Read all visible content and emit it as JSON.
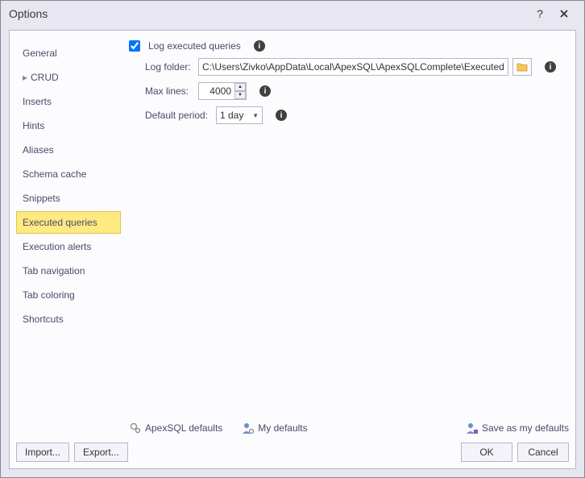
{
  "window": {
    "title": "Options"
  },
  "sidebar": {
    "items": [
      {
        "label": "General",
        "expandable": false
      },
      {
        "label": "CRUD",
        "expandable": true
      },
      {
        "label": "Inserts",
        "expandable": false
      },
      {
        "label": "Hints",
        "expandable": false
      },
      {
        "label": "Aliases",
        "expandable": false
      },
      {
        "label": "Schema cache",
        "expandable": false
      },
      {
        "label": "Snippets",
        "expandable": false
      },
      {
        "label": "Executed queries",
        "expandable": false,
        "selected": true
      },
      {
        "label": "Execution alerts",
        "expandable": false
      },
      {
        "label": "Tab navigation",
        "expandable": false
      },
      {
        "label": "Tab coloring",
        "expandable": false
      },
      {
        "label": "Shortcuts",
        "expandable": false
      }
    ]
  },
  "pane": {
    "log_checkbox_label": "Log executed queries",
    "log_checked": true,
    "log_folder_label": "Log folder:",
    "log_folder_value": "C:\\Users\\Zivko\\AppData\\Local\\ApexSQL\\ApexSQLComplete\\ExecutedQueries",
    "max_lines_label": "Max lines:",
    "max_lines_value": "4000",
    "default_period_label": "Default period:",
    "default_period_value": "1 day"
  },
  "defaults": {
    "apexsql": "ApexSQL defaults",
    "my": "My defaults",
    "save": "Save as my defaults"
  },
  "buttons": {
    "import": "Import...",
    "export": "Export...",
    "ok": "OK",
    "cancel": "Cancel"
  }
}
